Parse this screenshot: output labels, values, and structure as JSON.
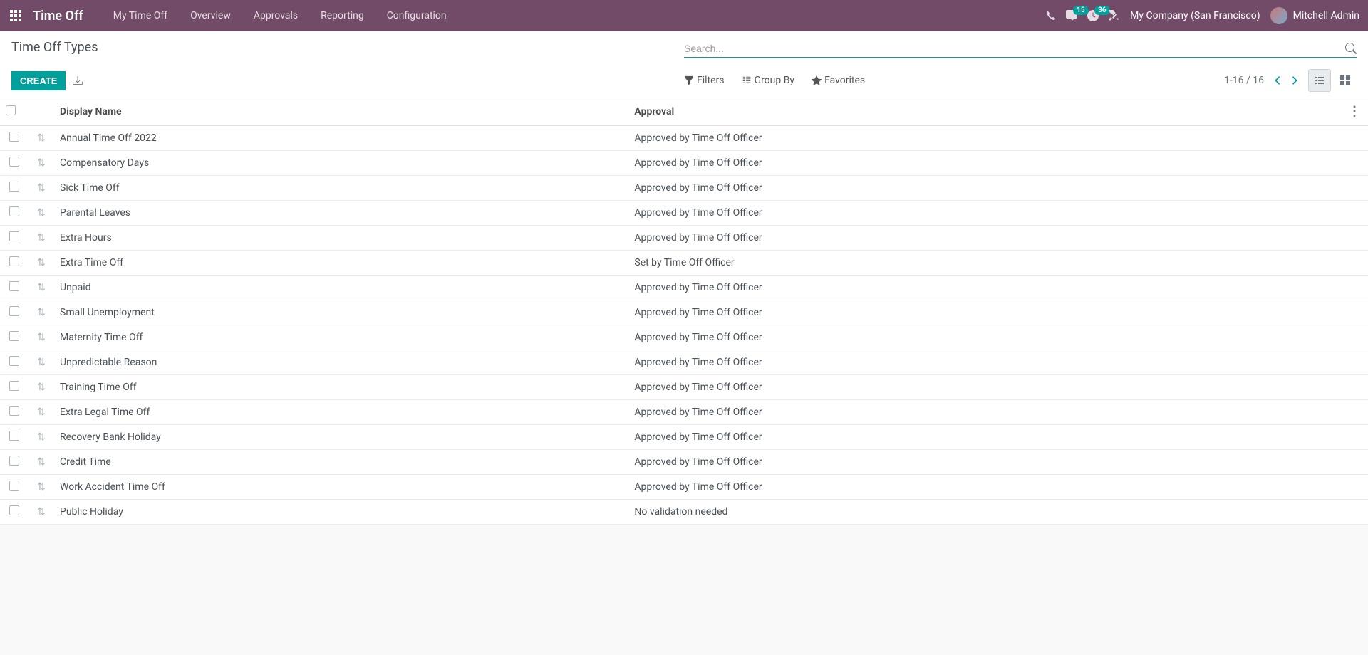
{
  "navbar": {
    "brand": "Time Off",
    "menu": [
      "My Time Off",
      "Overview",
      "Approvals",
      "Reporting",
      "Configuration"
    ],
    "messages_count": "15",
    "activities_count": "36",
    "company": "My Company (San Francisco)",
    "user": "Mitchell Admin"
  },
  "control_panel": {
    "title": "Time Off Types",
    "create_label": "CREATE",
    "search_placeholder": "Search...",
    "filters_label": "Filters",
    "groupby_label": "Group By",
    "favorites_label": "Favorites",
    "pager": "1-16 / 16"
  },
  "table": {
    "columns": {
      "display_name": "Display Name",
      "approval": "Approval"
    },
    "rows": [
      {
        "name": "Annual Time Off 2022",
        "approval": "Approved by Time Off Officer"
      },
      {
        "name": "Compensatory Days",
        "approval": "Approved by Time Off Officer"
      },
      {
        "name": "Sick Time Off",
        "approval": "Approved by Time Off Officer"
      },
      {
        "name": "Parental Leaves",
        "approval": "Approved by Time Off Officer"
      },
      {
        "name": "Extra Hours",
        "approval": "Approved by Time Off Officer"
      },
      {
        "name": "Extra Time Off",
        "approval": "Set by Time Off Officer"
      },
      {
        "name": "Unpaid",
        "approval": "Approved by Time Off Officer"
      },
      {
        "name": "Small Unemployment",
        "approval": "Approved by Time Off Officer"
      },
      {
        "name": "Maternity Time Off",
        "approval": "Approved by Time Off Officer"
      },
      {
        "name": "Unpredictable Reason",
        "approval": "Approved by Time Off Officer"
      },
      {
        "name": "Training Time Off",
        "approval": "Approved by Time Off Officer"
      },
      {
        "name": "Extra Legal Time Off",
        "approval": "Approved by Time Off Officer"
      },
      {
        "name": "Recovery Bank Holiday",
        "approval": "Approved by Time Off Officer"
      },
      {
        "name": "Credit Time",
        "approval": "Approved by Time Off Officer"
      },
      {
        "name": "Work Accident Time Off",
        "approval": "Approved by Time Off Officer"
      },
      {
        "name": "Public Holiday",
        "approval": "No validation needed"
      }
    ]
  }
}
